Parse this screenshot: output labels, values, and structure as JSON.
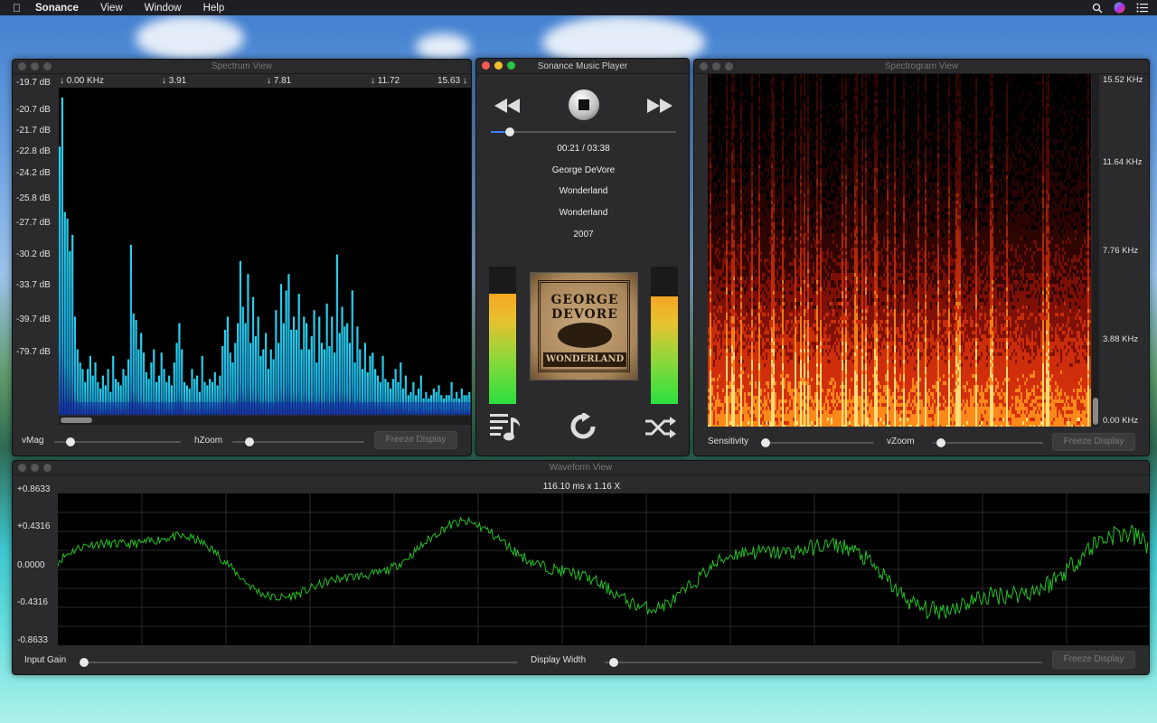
{
  "menubar": {
    "app": "Sonance",
    "items": [
      "View",
      "Window",
      "Help"
    ]
  },
  "spectrum": {
    "title": "Spectrum View",
    "db_labels": [
      "-19.7 dB",
      "-20.7 dB",
      "-21.7 dB",
      "-22.8 dB",
      "-24.2 dB",
      "-25.8 dB",
      "-27.7 dB",
      "-30.2 dB",
      "-33.7 dB",
      "-39.7 dB",
      "-79.7 dB"
    ],
    "freq_labels": [
      "↓ 0.00 KHz",
      "↓ 3.91",
      "↓ 7.81",
      "↓ 11.72",
      "15.63 ↓"
    ],
    "vmag_label": "vMag",
    "hzoom_label": "hZoom",
    "freeze_label": "Freeze Display",
    "vmag_value": 0.13,
    "hzoom_value": 0.13,
    "bar_levels": [
      0.82,
      0.97,
      0.62,
      0.6,
      0.5,
      0.55,
      0.3,
      0.2,
      0.16,
      0.14,
      0.1,
      0.14,
      0.18,
      0.12,
      0.16,
      0.1,
      0.08,
      0.12,
      0.09,
      0.14,
      0.07,
      0.18,
      0.11,
      0.1,
      0.09,
      0.14,
      0.12,
      0.17,
      0.52,
      0.31,
      0.29,
      0.2,
      0.25,
      0.19,
      0.13,
      0.11,
      0.16,
      0.2,
      0.1,
      0.12,
      0.19,
      0.14,
      0.1,
      0.12,
      0.09,
      0.16,
      0.22,
      0.28,
      0.2,
      0.1,
      0.09,
      0.08,
      0.14,
      0.11,
      0.12,
      0.07,
      0.18,
      0.1,
      0.09,
      0.11,
      0.1,
      0.13,
      0.09,
      0.12,
      0.21,
      0.26,
      0.3,
      0.19,
      0.16,
      0.22,
      0.28,
      0.47,
      0.33,
      0.28,
      0.43,
      0.22,
      0.36,
      0.24,
      0.3,
      0.18,
      0.2,
      0.25,
      0.14,
      0.2,
      0.17,
      0.32,
      0.22,
      0.4,
      0.28,
      0.38,
      0.43,
      0.26,
      0.3,
      0.26,
      0.37,
      0.2,
      0.3,
      0.28,
      0.2,
      0.24,
      0.32,
      0.16,
      0.3,
      0.22,
      0.2,
      0.34,
      0.21,
      0.3,
      0.19,
      0.49,
      0.25,
      0.33,
      0.27,
      0.28,
      0.22,
      0.38,
      0.16,
      0.27,
      0.2,
      0.14,
      0.22,
      0.13,
      0.18,
      0.19,
      0.14,
      0.12,
      0.1,
      0.18,
      0.11,
      0.1,
      0.08,
      0.11,
      0.14,
      0.1,
      0.16,
      0.08,
      0.12,
      0.06,
      0.07,
      0.1,
      0.06,
      0.08,
      0.12,
      0.05,
      0.07,
      0.05,
      0.06,
      0.08,
      0.07,
      0.09,
      0.06,
      0.05,
      0.06,
      0.06,
      0.1,
      0.05,
      0.07,
      0.05,
      0.08,
      0.06,
      0.06,
      0.07
    ]
  },
  "player": {
    "title": "Sonance Music Player",
    "time": "00:21 / 03:38",
    "artist": "George DeVore",
    "album": "Wonderland",
    "track": "Wonderland",
    "year": "2007",
    "progress": 0.1,
    "vu_left": 0.72,
    "vu_right": 0.7,
    "art_text": [
      "GEORGE",
      "DEVORE",
      "WONDERLAND"
    ],
    "icons": {
      "rewind": "rewind-icon",
      "stop": "stop-icon",
      "forward": "fast-forward-icon",
      "playlist": "playlist-icon",
      "repeat": "repeat-icon",
      "shuffle": "shuffle-icon"
    }
  },
  "spectrogram": {
    "title": "Spectrogram View",
    "freq_labels": [
      "15.52 KHz",
      "11.64 KHz",
      "7.76 KHz",
      "3.88 KHz",
      "0.00 KHz"
    ],
    "sensitivity_label": "Sensitivity",
    "vzoom_label": "vZoom",
    "freeze_label": "Freeze Display",
    "sensitivity_value": 0.05,
    "vzoom_value": 0.07
  },
  "waveform": {
    "title": "Waveform View",
    "scale_text": "116.10 ms x 1.16 X",
    "amp_labels": [
      "+0.8633",
      "+0.4316",
      "0.0000",
      "-0.4316",
      "-0.8633"
    ],
    "input_gain_label": "Input Gain",
    "display_width_label": "Display Width",
    "freeze_label": "Freeze Display",
    "input_gain_value": 0.01,
    "display_width_value": 0.02
  }
}
